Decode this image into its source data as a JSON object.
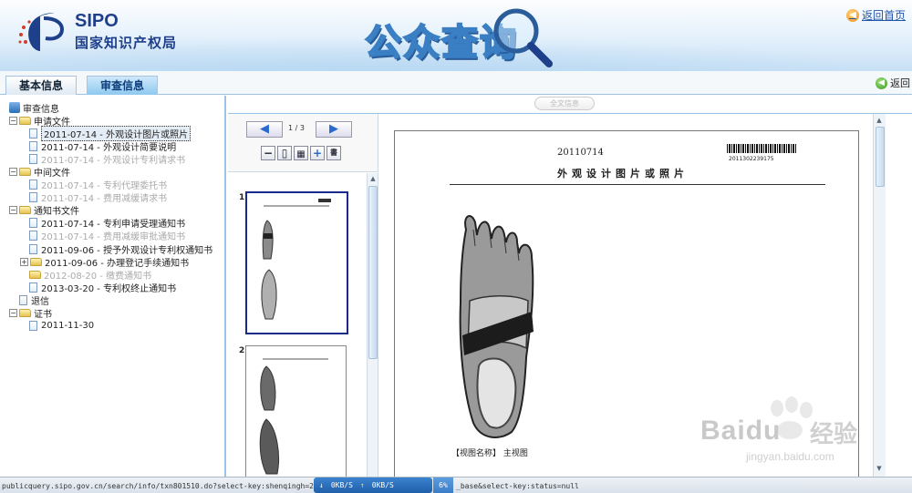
{
  "header": {
    "logo_en": "SIPO",
    "logo_cn": "国家知识产权局",
    "banner_title": "公众查询",
    "home_link": "返回首页"
  },
  "tabs": [
    {
      "label": "基本信息",
      "active": false
    },
    {
      "label": "审查信息",
      "active": true
    }
  ],
  "back_label": "返回",
  "tree": {
    "root": "审查信息",
    "groups": [
      {
        "label": "申请文件",
        "items": [
          {
            "text": "2011-07-14 - 外观设计图片或照片",
            "state": "selected"
          },
          {
            "text": "2011-07-14 - 外观设计简要说明",
            "state": "normal"
          },
          {
            "text": "2011-07-14 - 外观设计专利请求书",
            "state": "disabled"
          }
        ]
      },
      {
        "label": "中间文件",
        "items": [
          {
            "text": "2011-07-14 - 专利代理委托书",
            "state": "disabled"
          },
          {
            "text": "2011-07-14 - 费用减缓请求书",
            "state": "disabled"
          }
        ]
      },
      {
        "label": "通知书文件",
        "items": [
          {
            "text": "2011-07-14 - 专利申请受理通知书",
            "state": "normal"
          },
          {
            "text": "2011-07-14 - 费用减缓审批通知书",
            "state": "disabled"
          },
          {
            "text": "2011-09-06 - 授予外观设计专利权通知书",
            "state": "normal"
          },
          {
            "text": "2011-09-06 - 办理登记手续通知书",
            "state": "normal"
          },
          {
            "text": "2012-08-20 - 缴费通知书",
            "state": "disabled"
          },
          {
            "text": "2013-03-20 - 专利权终止通知书",
            "state": "normal"
          }
        ]
      }
    ],
    "tuixin": "退信",
    "zhengshu": "证书",
    "zhengshu_item": "2011-11-30"
  },
  "viewer": {
    "top_pill": "全文信息",
    "page_indicator": "1 / 3",
    "prev_icon": "left-arrow-icon",
    "next_icon": "right-arrow-icon",
    "thumb_numbers": [
      "1",
      "2"
    ],
    "doc_date": "20110714",
    "barcode_number": "2011302239175",
    "doc_title": "外观设计图片或照片",
    "view_label_prefix": "【视图名称】",
    "view_label_value": "主视图"
  },
  "status_bar": {
    "url": "publicquery.sipo.gov.cn/search/info/txn801510.do?select-key:shenqingh=20",
    "url_tail": "_base&select-key:status=null",
    "down_speed": "0KB/S",
    "up_speed": "0KB/S",
    "percent": "6%"
  },
  "watermark": {
    "text": "Bai",
    "suffix": "du",
    "cn": "经验",
    "url": "jingyan.baidu.com"
  },
  "colors": {
    "accent": "#2a6cb4",
    "tab_active": "#8ec8ef",
    "border": "#9cc2e4",
    "thumb_selected": "#1a2a8c"
  }
}
